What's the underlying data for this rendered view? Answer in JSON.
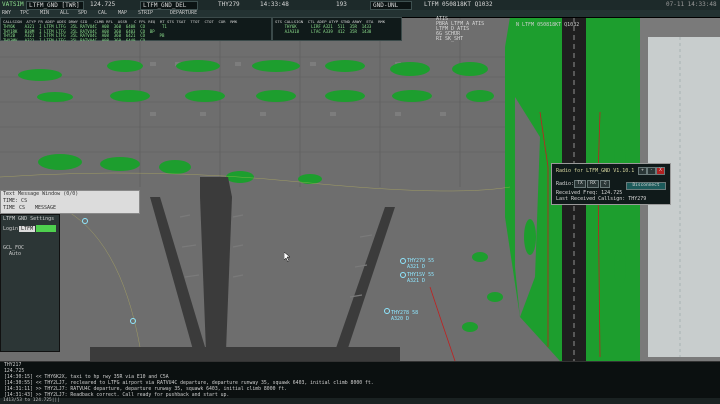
{
  "topbar": {
    "app_name": "VATSIM",
    "station": "LTFM_GND [TWR]",
    "freq": "124.725",
    "secondary_station": "LTFM_GND_DEL",
    "callsign": "THY279",
    "time": "14:33:48",
    "counter": "193",
    "profile": "GND-UNL",
    "metar": "LTFM 050818KT Q1032",
    "clock_right": "07-11 14:33:48"
  },
  "subbar": {
    "items": [
      "RWY",
      "TPC",
      "MIN",
      "ALL",
      "SPD",
      "CAL",
      "MAP",
      "STRIP",
      "DEPARTURE"
    ]
  },
  "departure_list": {
    "header": "CALLSIGN  ATYP FR ADEP ADES DRWY SID   CLMB RFL  ASSR   C FPL REQ  RT STS TSAT  TTOT  CTOT  COR  RMK",
    "rows": [
      "THY6K    A321  I LTFM LTFG  35L RATVU4C  A08  360  6408  CO       T1",
      "THY1RK   B38M  I LTFM LTFG  35L RATVU4C  A08  360  6403  CO  BP",
      "THY2B    A321  I LTFM LTFG  35L RATVU4C  A08  360  6421  CO      PB",
      "THY3MV   A321  I LTFM LTFG  35L RATVU4C  A08  360  6440  CO"
    ]
  },
  "arrival_list": {
    "header": "STS CALLSIGN  CTL ADEP ATYP STND ARWY  ETA  RMK",
    "rows": [
      "    THY6K      LIRF A321  511  35R  1433",
      "    AJA318     LTAC A339  412  35R  1438",
      "",
      ""
    ]
  },
  "weather_box": {
    "lines": [
      "ATIS",
      "PBRA LTFM_A ATIS",
      "LTFM_D_ATIS",
      "6G SCHUR",
      "RI SK_SHT"
    ]
  },
  "runway_label": "N LTFM 050818KT Q1032",
  "aircraft": [
    {
      "callsign": "THY279 55",
      "type": "A321 D"
    },
    {
      "callsign": "THY1SV 55",
      "type": "A321 D"
    },
    {
      "callsign": "THY278 58",
      "type": "A320 D"
    }
  ],
  "radio_panel": {
    "title": "Radio for LTFM_GND V1.10.1",
    "radio_label": "Radio:",
    "tx_label": "TX",
    "rx_label": "RX",
    "received_freq_label": "Received Freq: 124.725",
    "last_received_label": "Last Received Callsign: THY279",
    "disconnect_label": "Disconnect",
    "plus_label": "+",
    "minus_label": "-",
    "dash_label": "-",
    "close_label": "X"
  },
  "message_window": {
    "title": "Text Message Window (0/0)",
    "tab": "TIME: CS",
    "cols": [
      "TIME",
      "CS",
      "MESSAGE"
    ]
  },
  "login_panel": {
    "title": "LTFM GND Settings",
    "login_label": "Login",
    "login_value": "LTFM",
    "checklist_title": "GCL_FOC",
    "checklist_item": "Auto"
  },
  "console": {
    "lines": [
      "THY217",
      "124.725",
      "[14:30:15] << THY6K2X, taxi to hp rwy 35R via E10 and C5A",
      "[14:30:55] << THY2LJ7, recleared to LTFG airport via RATVU4C departure, departure runway 35, squawk 6403, initial climb 8000 ft.",
      "[14:31:11] >> THY2LJ7: RATVU4C departure, departure runway 35, squawk 6403, initial climb 8000 ft.",
      "[14:31:43] >> THY2LJ7: Readback correct. Call ready for pushback and start up."
    ]
  },
  "statusbar": {
    "text": "1413/53 to 124.725|||"
  },
  "colors": {
    "grass": "#1d9e2e",
    "pavement": "#6e6e6e",
    "runway": "#1f1f1f",
    "terminal": "#3b3b3b",
    "taxi_line": "#c9c25a",
    "edge_red": "#c02020",
    "tag_text": "#8fe7ff"
  }
}
